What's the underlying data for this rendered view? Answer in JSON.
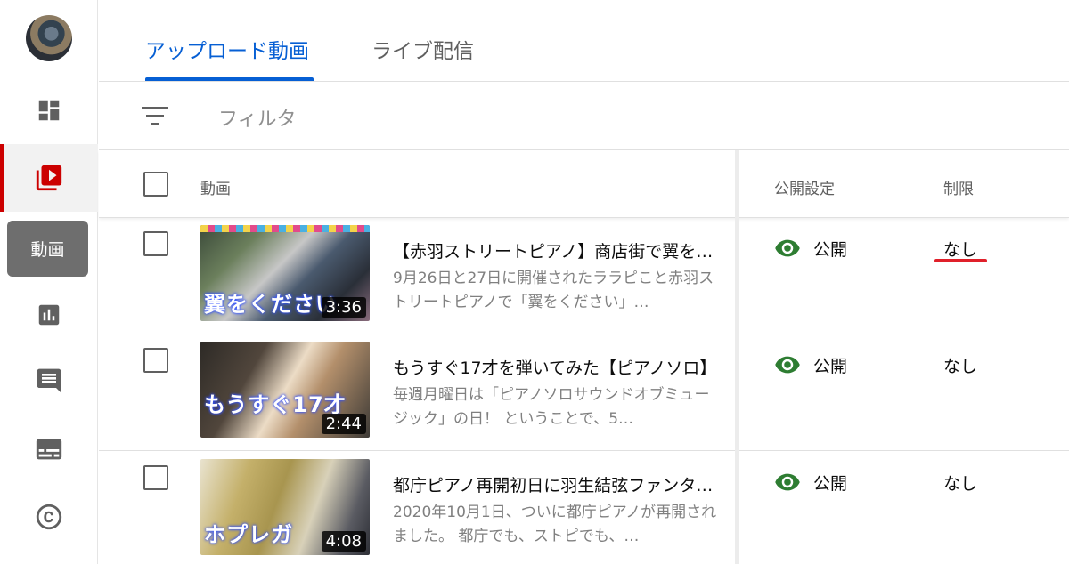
{
  "sidebar": {
    "tooltip": "動画",
    "icons": [
      "dashboard-icon",
      "video-library-icon",
      "analytics-icon",
      "comments-icon",
      "subtitles-icon",
      "copyright-icon"
    ]
  },
  "tabs": [
    {
      "label": "アップロード動画",
      "active": true
    },
    {
      "label": "ライブ配信",
      "active": false
    }
  ],
  "filter": {
    "placeholder": "フィルタ"
  },
  "table": {
    "headers": {
      "video": "動画",
      "visibility": "公開設定",
      "restrictions": "制限"
    },
    "rows": [
      {
        "title": "【赤羽ストリートピアノ】商店街で翼をください",
        "description": "9月26日と27日に開催されたララピこと赤羽ストリートピアノで「翼をください」…",
        "duration": "3:36",
        "thumb_text": "翼をください",
        "visibility": "公開",
        "restriction": "なし"
      },
      {
        "title": "もうすぐ17才を弾いてみた【ピアノソロ】",
        "description": "毎週月曜日は「ピアノソロサウンドオブミュージック」の日！ ということで、5…",
        "duration": "2:44",
        "thumb_text": "もうすぐ17才",
        "visibility": "公開",
        "restriction": "なし"
      },
      {
        "title": "都庁ピアノ再開初日に羽生結弦ファンタジー",
        "description": "2020年10月1日、ついに都庁ピアノが再開されました。 都庁でも、ストピでも、…",
        "duration": "4:08",
        "thumb_text": "ホプレガ",
        "visibility": "公開",
        "restriction": "なし"
      }
    ]
  },
  "colors": {
    "accent": "#065fd4",
    "brand_red": "#cc0000",
    "visibility_green": "#2e7d32"
  }
}
